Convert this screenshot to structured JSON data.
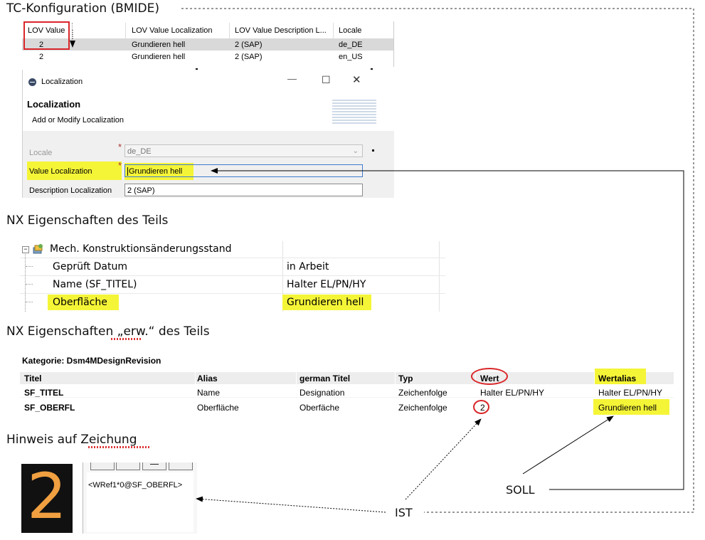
{
  "sections": {
    "tc": "TC-Konfiguration (BMIDE)",
    "nx": "NX Eigenschaften des Teils",
    "nx_ext": "NX Eigenschaften „erw.“ des Teils",
    "hinweis": "Hinweis auf Zeichung"
  },
  "lov_table": {
    "headers": [
      "LOV Value",
      "LOV Value Localization",
      "LOV Value Description L...",
      "Locale"
    ],
    "rows": [
      [
        "2",
        "Grundieren hell",
        "2 (SAP)",
        "de_DE"
      ],
      [
        "2",
        "Grundieren hell",
        "2 (SAP)",
        "en_US"
      ]
    ]
  },
  "dialog": {
    "title": "Localization",
    "heading": "Localization",
    "subheading": "Add or Modify Localization",
    "locale_label": "Locale",
    "locale_value": "de_DE",
    "value_label": "Value Localization",
    "value_value": "Grundieren hell",
    "desc_label": "Description Localization",
    "desc_value": "2 (SAP)",
    "required_mark": "*",
    "btn_minimize": "—",
    "btn_maximize": "☐",
    "btn_close": "✕"
  },
  "nx_props": {
    "group": "Mech. Konstruktionsänderungsstand",
    "rows": [
      {
        "name": "Geprüft Datum",
        "value": "in Arbeit"
      },
      {
        "name": "Name (SF_TITEL)",
        "value": "Halter EL/PN/HY"
      },
      {
        "name": "Oberfläche",
        "value": "Grundieren hell"
      }
    ]
  },
  "ext_table": {
    "category": "Kategorie: Dsm4MDesignRevision",
    "headers": [
      "Titel",
      "Alias",
      "german Titel",
      "Typ",
      "Wert",
      "Wertalias"
    ],
    "rows": [
      [
        "SF_TITEL",
        "Name",
        "Designation",
        "Zeichenfolge",
        "Halter EL/PN/HY",
        "Halter EL/PN/HY"
      ],
      [
        "SF_OBERFL",
        "Oberfläche",
        "Oberfäche",
        "Zeichenfolge",
        "2",
        "Grundieren hell"
      ]
    ]
  },
  "drawing": {
    "big_digit": "2",
    "code_text": "<WRef1*0@SF_OBERFL>"
  },
  "annotations": {
    "soll": "SOLL",
    "ist": "IST"
  },
  "colors": {
    "highlight": "#f5f538",
    "red": "#d9262a",
    "digit": "#f0a040"
  }
}
